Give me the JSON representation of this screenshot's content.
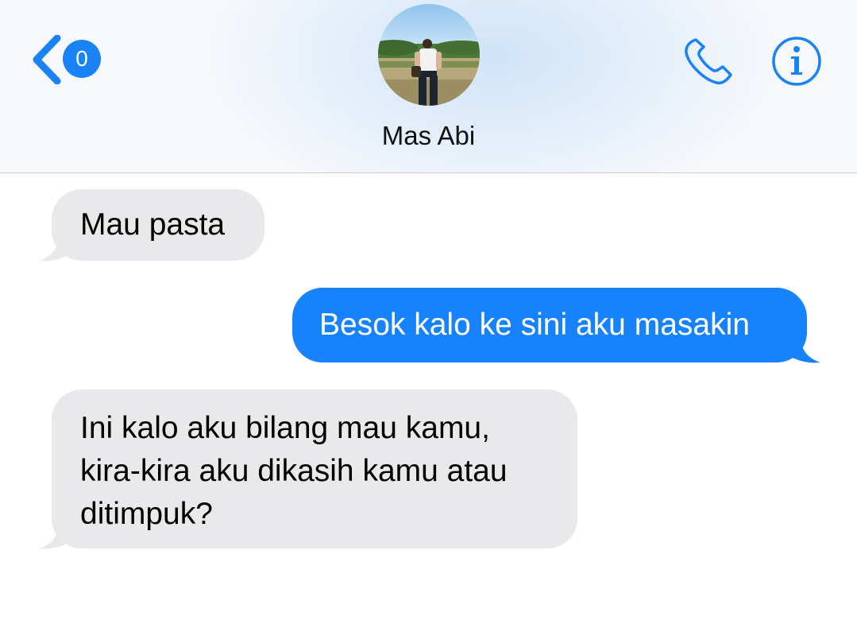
{
  "header": {
    "back_badge_count": "0",
    "contact_name": "Mas Abi",
    "avatar_icon": "contact-photo",
    "call_icon": "phone-icon",
    "info_icon": "info-icon",
    "accent_color": "#1a82f7"
  },
  "messages": [
    {
      "direction": "incoming",
      "lines": [
        "Mau pasta"
      ]
    },
    {
      "direction": "outgoing",
      "lines": [
        "Besok kalo ke sini aku masakin"
      ]
    },
    {
      "direction": "incoming",
      "lines": [
        "Ini kalo aku bilang mau kamu,",
        "kira-kira aku dikasih kamu atau",
        "ditimpuk?"
      ]
    }
  ],
  "colors": {
    "incoming_bubble": "#e9e9eb",
    "outgoing_bubble": "#1682fb",
    "header_bg": "#f6f8fb"
  }
}
